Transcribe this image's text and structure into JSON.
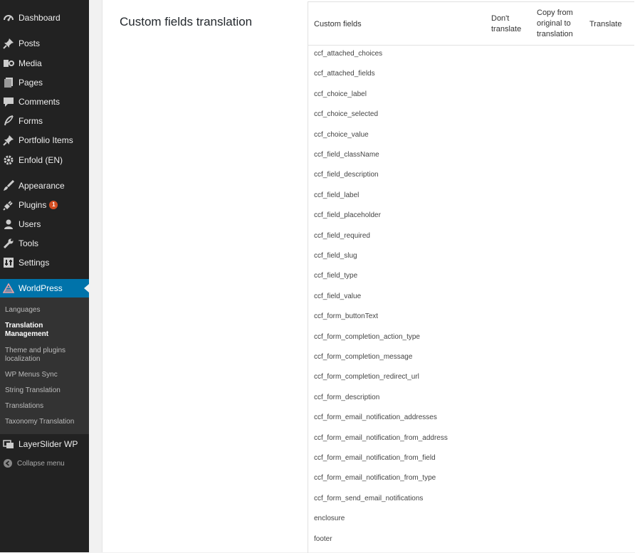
{
  "sidebar": {
    "items": [
      {
        "label": "Dashboard",
        "icon": "dashboard-icon"
      },
      {
        "label": "Posts",
        "icon": "pin-icon"
      },
      {
        "label": "Media",
        "icon": "media-icon"
      },
      {
        "label": "Pages",
        "icon": "pages-icon"
      },
      {
        "label": "Comments",
        "icon": "comment-icon"
      },
      {
        "label": "Forms",
        "icon": "feather-icon"
      },
      {
        "label": "Portfolio Items",
        "icon": "pin-icon"
      },
      {
        "label": "Enfold (EN)",
        "icon": "gear-icon"
      },
      {
        "label": "Appearance",
        "icon": "brush-icon"
      },
      {
        "label": "Plugins",
        "icon": "plug-icon",
        "badge": "1"
      },
      {
        "label": "Users",
        "icon": "user-icon"
      },
      {
        "label": "Tools",
        "icon": "wrench-icon"
      },
      {
        "label": "Settings",
        "icon": "settings-icon"
      },
      {
        "label": "WorldPress",
        "icon": "wpml-icon"
      }
    ],
    "submenu": [
      "Languages",
      "Translation Management",
      "Theme and plugins localization",
      "WP Menus Sync",
      "String Translation",
      "Translations",
      "Taxonomy Translation"
    ],
    "extra_item": {
      "label": "LayerSlider WP",
      "icon": "layers-icon"
    },
    "collapse_label": "Collapse menu"
  },
  "page": {
    "title": "Custom fields translation"
  },
  "table": {
    "headers": {
      "field": "Custom fields",
      "dont": "Don't translate",
      "copy": "Copy from original to translation",
      "translate": "Translate"
    },
    "rows": [
      {
        "name": "ccf_attached_choices",
        "selected": "dont"
      },
      {
        "name": "ccf_attached_fields",
        "selected": "dont"
      },
      {
        "name": "ccf_choice_label",
        "selected": "translate"
      },
      {
        "name": "ccf_choice_selected",
        "selected": "translate"
      },
      {
        "name": "ccf_choice_value",
        "selected": "dont"
      },
      {
        "name": "ccf_field_className",
        "selected": "dont"
      },
      {
        "name": "ccf_field_description",
        "selected": "translate"
      },
      {
        "name": "ccf_field_label",
        "selected": "translate"
      },
      {
        "name": "ccf_field_placeholder",
        "selected": "translate"
      },
      {
        "name": "ccf_field_required",
        "selected": "dont"
      },
      {
        "name": "ccf_field_slug",
        "selected": "dont"
      },
      {
        "name": "ccf_field_type",
        "selected": "dont"
      },
      {
        "name": "ccf_field_value",
        "selected": "dont"
      },
      {
        "name": "ccf_form_buttonText",
        "selected": "translate"
      },
      {
        "name": "ccf_form_completion_action_type",
        "selected": "dont"
      },
      {
        "name": "ccf_form_completion_message",
        "selected": "translate"
      },
      {
        "name": "ccf_form_completion_redirect_url",
        "selected": "dont"
      },
      {
        "name": "ccf_form_description",
        "selected": "translate"
      },
      {
        "name": "ccf_form_email_notification_addresses",
        "selected": "dont"
      },
      {
        "name": "ccf_form_email_notification_from_address",
        "selected": "dont"
      },
      {
        "name": "ccf_form_email_notification_from_field",
        "selected": "dont"
      },
      {
        "name": "ccf_form_email_notification_from_type",
        "selected": "dont"
      },
      {
        "name": "ccf_form_send_email_notifications",
        "selected": "dont"
      },
      {
        "name": "enclosure",
        "selected": "none"
      },
      {
        "name": "footer",
        "selected": "none"
      }
    ]
  },
  "colors": {
    "sidebar_bg": "#222222",
    "submenu_bg": "#333333",
    "active_bg": "#0073aa",
    "badge_bg": "#d54e21"
  }
}
